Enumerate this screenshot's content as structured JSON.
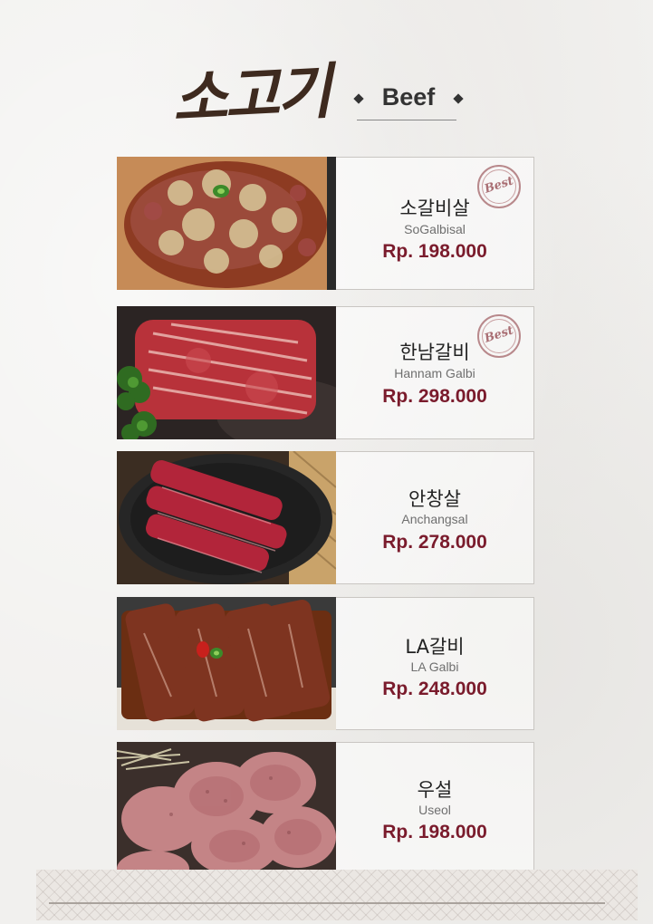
{
  "header": {
    "title_kr": "소고기",
    "title_en": "Beef"
  },
  "items": [
    {
      "name_kr": "소갈비살",
      "name_en": "SoGalbisal",
      "price": "Rp. 198.000",
      "badge": "Best"
    },
    {
      "name_kr": "한남갈비",
      "name_en": "Hannam Galbi",
      "price": "Rp. 298.000",
      "badge": "Best"
    },
    {
      "name_kr": "안창살",
      "name_en": "Anchangsal",
      "price": "Rp. 278.000"
    },
    {
      "name_kr": "LA갈비",
      "name_en": "LA Galbi",
      "price": "Rp. 248.000"
    },
    {
      "name_kr": "우설",
      "name_en": "Useol",
      "price": "Rp. 198.000"
    }
  ],
  "colors": {
    "price": "#7a1b2c",
    "title": "#3e2a1f",
    "badge": "#a96e73"
  }
}
